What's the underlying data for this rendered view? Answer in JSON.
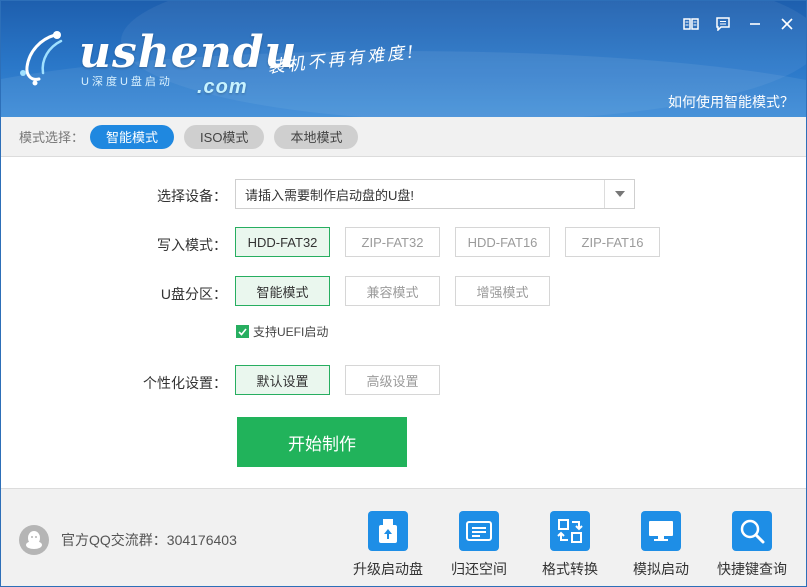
{
  "header": {
    "logo_text": "ushendu",
    "logo_domain": ".com",
    "logo_subtitle": "U深度U盘启动",
    "slogan": "装机不再有难度!",
    "help_link": "如何使用智能模式？"
  },
  "modebar": {
    "label": "模式选择：",
    "modes": [
      "智能模式",
      "ISO模式",
      "本地模式"
    ],
    "active_index": 0
  },
  "form": {
    "device": {
      "label": "选择设备：",
      "value": "请插入需要制作启动盘的U盘!"
    },
    "write_mode": {
      "label": "写入模式：",
      "options": [
        "HDD-FAT32",
        "ZIP-FAT32",
        "HDD-FAT16",
        "ZIP-FAT16"
      ],
      "selected_index": 0
    },
    "partition": {
      "label": "U盘分区：",
      "options": [
        "智能模式",
        "兼容模式",
        "增强模式"
      ],
      "selected_index": 0
    },
    "uefi": {
      "label": "支持UEFI启动",
      "checked": true
    },
    "personalize": {
      "label": "个性化设置：",
      "options": [
        "默认设置",
        "高级设置"
      ],
      "selected_index": 0
    },
    "start_button": "开始制作"
  },
  "footer": {
    "qq_group": "官方QQ交流群：304176403",
    "tools": [
      {
        "label": "升级启动盘",
        "icon": "upgrade-disk-icon"
      },
      {
        "label": "归还空间",
        "icon": "restore-space-icon"
      },
      {
        "label": "格式转换",
        "icon": "format-convert-icon"
      },
      {
        "label": "模拟启动",
        "icon": "simulate-boot-icon"
      },
      {
        "label": "快捷键查询",
        "icon": "hotkey-search-icon"
      }
    ]
  },
  "colors": {
    "header_blue": "#2a77c8",
    "active_pill": "#1f88e0",
    "selected_green": "#27ae60",
    "start_button": "#21b35b",
    "tool_icon_blue": "#1e8ee6"
  }
}
